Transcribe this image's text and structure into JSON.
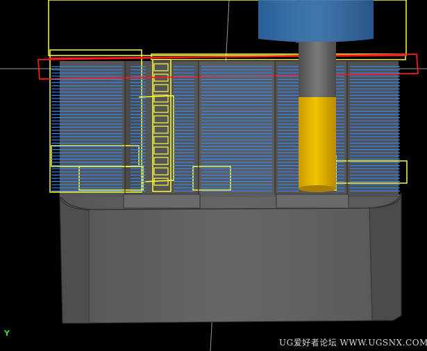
{
  "viewport": {
    "axis_label": "Y",
    "watermark": "UG爱好者论坛 WWW.UGSNX.COM"
  },
  "colors": {
    "background": "#000000",
    "part_body": "#5f5f5f",
    "toolpath": "#2f86ff",
    "boundary": "#ffff33",
    "cut_region": "#ff1a1a",
    "tool_shank": "#6a6a6a",
    "tool_flute": "#e6b800",
    "tool_holder": "#3f78b3"
  }
}
